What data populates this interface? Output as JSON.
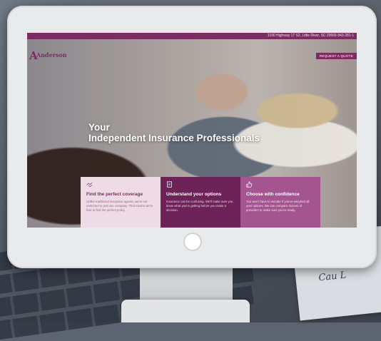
{
  "website": {
    "topbar_text": "1190 Highway 17 S2, Little River, SC 29566    843-281-1",
    "logo_text": "Anderson",
    "quote_button": "REQUEST A QUOTE",
    "headline_line1": "Your",
    "headline_line2": "Independent Insurance Professionals",
    "cards": [
      {
        "icon": "handshake-icon",
        "title": "Find the perfect coverage",
        "body": "Unlike traditional insurance agents, we're not restricted to just one company. That means we're free to find the perfect policy"
      },
      {
        "icon": "document-icon",
        "title": "Understand your options",
        "body": "Insurance can be confusing. We'll make sure you know what you're getting before you make a decision."
      },
      {
        "icon": "thumbs-up-icon",
        "title": "Choose with confidence",
        "body": "You won't have to wonder if you've weighed all your options. We can compare dozens of providers to make sure you're ready."
      }
    ]
  },
  "background_note_text": "ct n\nCau L",
  "colors": {
    "brand": "#7b2d63",
    "card_light": "#efdbe6",
    "card_dark": "#6d2258",
    "card_medium": "#a45590"
  }
}
